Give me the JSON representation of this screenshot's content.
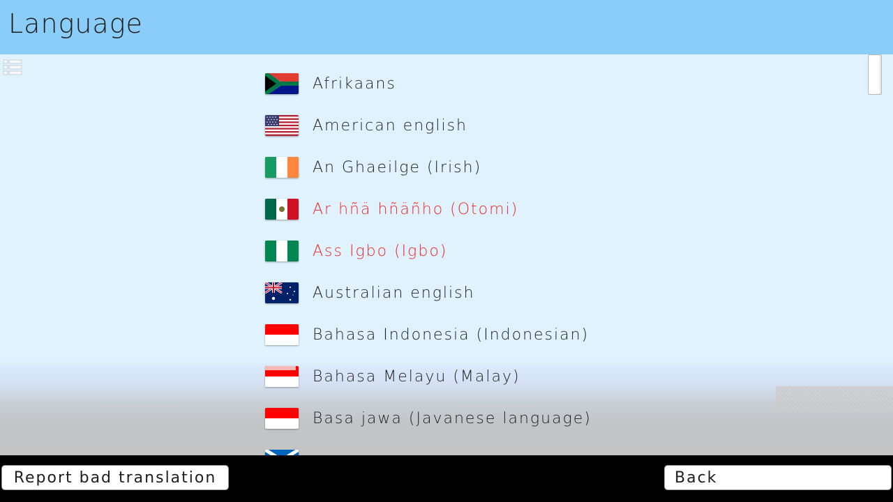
{
  "header": {
    "title": "Language"
  },
  "languages": [
    {
      "label": "Afrikaans",
      "flag": "south-africa"
    },
    {
      "label": "American english",
      "flag": "usa"
    },
    {
      "label": "An Ghaeilge (Irish)",
      "flag": "ireland"
    },
    {
      "label": "Ar hñä hñäñho (Otomi)",
      "flag": "mexico",
      "untranslated": true
    },
    {
      "label": "Ass Igbo (Igbo)",
      "flag": "nigeria",
      "untranslated": true
    },
    {
      "label": "Australian english",
      "flag": "australia"
    },
    {
      "label": "Bahasa Indonesia (Indonesian)",
      "flag": "indonesia"
    },
    {
      "label": "Bahasa Melayu (Malay)",
      "flag": "malaysia"
    },
    {
      "label": "Basa jawa (Javanese language)",
      "flag": "indonesia"
    },
    {
      "label": "",
      "flag": "scotland"
    }
  ],
  "footer": {
    "report_label": "Report bad translation",
    "back_label": "Back"
  },
  "colors": {
    "header_bg": "#89cdf8",
    "list_bg": "#e0f2fd",
    "untranslated_text": "#ee2828"
  }
}
